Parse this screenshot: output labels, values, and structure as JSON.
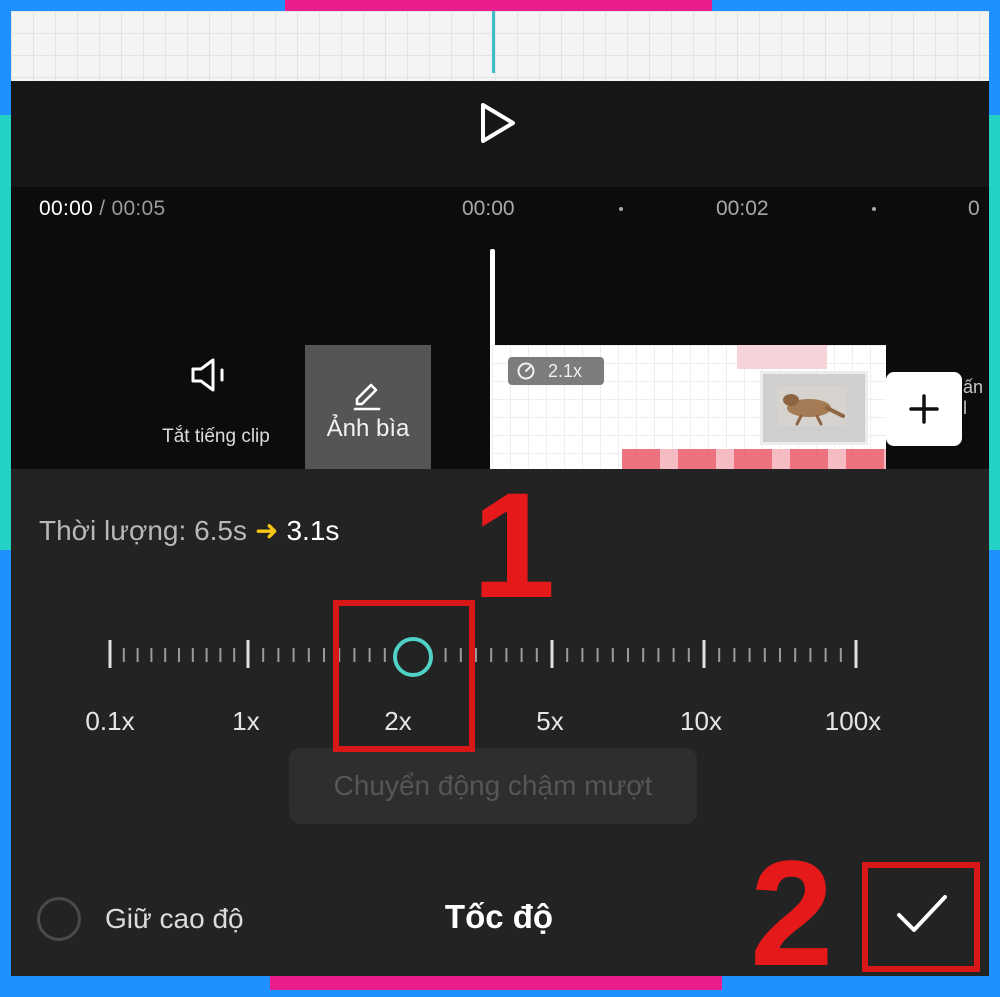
{
  "timeline": {
    "current_time": "00:00",
    "separator": " / ",
    "total_time": "00:05",
    "ruler_labels": [
      "00:00",
      "00:02",
      "0"
    ]
  },
  "toolbar": {
    "mute_label": "Tắt tiếng clip",
    "cover_label": "Ảnh bìa",
    "edge_label": "ấn l"
  },
  "clip": {
    "speed_badge": "2.1x"
  },
  "speed_panel": {
    "duration_label": "Thời lượng:",
    "duration_old": "6.5s",
    "duration_new": "3.1s",
    "slider_value": "2.1x",
    "speed_marks": [
      "0.1x",
      "1x",
      "2x",
      "5x",
      "10x",
      "100x"
    ],
    "smooth_label": "Chuyển động chậm mượt",
    "keep_pitch_label": "Giữ cao độ",
    "title": "Tốc độ"
  },
  "annotations": {
    "step1": "1",
    "step2": "2"
  },
  "colors": {
    "accent": "#4fd1c5",
    "annotation": "#d81818",
    "arrow": "#f5c518"
  },
  "icons": [
    "play-icon",
    "speaker-mute-icon",
    "edit-pencil-icon",
    "speed-gauge-icon",
    "plus-icon",
    "checkmark-icon"
  ]
}
